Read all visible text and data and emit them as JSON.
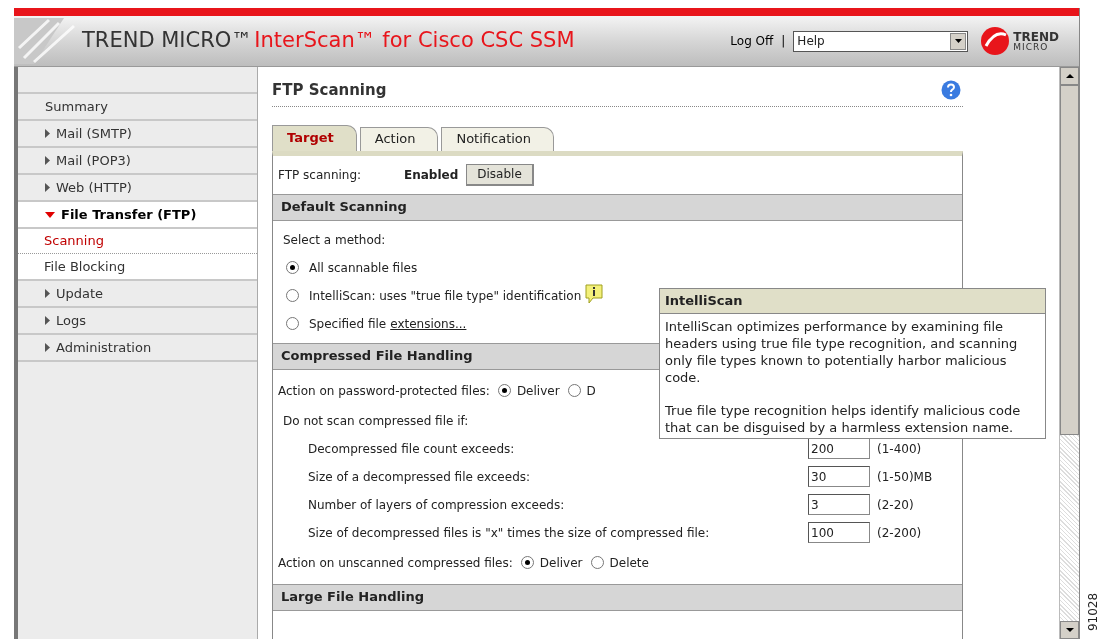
{
  "header": {
    "brand": "TREND MICRO™",
    "product": "InterScan™ for Cisco CSC SSM",
    "logoff": "Log Off",
    "separator": "|",
    "help_select": {
      "value": "Help"
    },
    "logo_text": [
      "TREND",
      "MICRO"
    ]
  },
  "sidebar": {
    "items": [
      {
        "label": "Summary",
        "kind": "link",
        "selected": false
      },
      {
        "label": "Mail (SMTP)",
        "kind": "group",
        "expanded": false,
        "selected": false
      },
      {
        "label": "Mail (POP3)",
        "kind": "group",
        "expanded": false,
        "selected": false
      },
      {
        "label": "Web (HTTP)",
        "kind": "group",
        "expanded": false,
        "selected": false
      },
      {
        "label": "File Transfer (FTP)",
        "kind": "group",
        "expanded": true,
        "selected": true,
        "children": [
          {
            "label": "Scanning",
            "selected": true
          },
          {
            "label": "File Blocking",
            "selected": false
          }
        ]
      },
      {
        "label": "Update",
        "kind": "group",
        "expanded": false,
        "selected": false
      },
      {
        "label": "Logs",
        "kind": "group",
        "expanded": false,
        "selected": false
      },
      {
        "label": "Administration",
        "kind": "group",
        "expanded": false,
        "selected": false
      }
    ]
  },
  "page": {
    "title": "FTP Scanning",
    "tabs": [
      {
        "label": "Target",
        "selected": true
      },
      {
        "label": "Action",
        "selected": false
      },
      {
        "label": "Notification",
        "selected": false
      }
    ],
    "status_row": {
      "label": "FTP scanning:",
      "value": "Enabled",
      "button": "Disable"
    },
    "sections": [
      {
        "title": "Default Scanning",
        "rows": [
          {
            "kind": "text",
            "label": "Select a method:"
          },
          {
            "kind": "option",
            "label": "All scannable files",
            "selected": true
          },
          {
            "kind": "option",
            "label": "IntelliScan: uses \"true file type\" identification",
            "selected": false,
            "info": true
          },
          {
            "kind": "option",
            "label": "Specified file",
            "link": "extensions...",
            "selected": false
          }
        ]
      },
      {
        "title": "Compressed File Handling",
        "rows": [
          {
            "kind": "radio",
            "label": "Action on password-protected files:",
            "options": [
              {
                "label": "Deliver",
                "selected": true
              },
              {
                "label": "D",
                "selected": false
              }
            ]
          },
          {
            "kind": "text",
            "label": "Do not scan compressed file if:"
          },
          {
            "kind": "number",
            "label": "Decompressed file count exceeds:",
            "value": "200",
            "range": "(1-400)"
          },
          {
            "kind": "number",
            "label": "Size of a decompressed file exceeds:",
            "value": "30",
            "range": "(1-50)MB"
          },
          {
            "kind": "number",
            "label": "Number of layers of compression exceeds:",
            "value": "3",
            "range": "(2-20)"
          },
          {
            "kind": "number",
            "label": "Size of decompressed files is \"x\" times the size of compressed file:",
            "value": "100",
            "range": "(2-200)"
          },
          {
            "kind": "radio",
            "label": "Action on unscanned compressed files:",
            "options": [
              {
                "label": "Deliver",
                "selected": true
              },
              {
                "label": "Delete",
                "selected": false
              }
            ]
          }
        ]
      },
      {
        "title": "Large File Handling"
      }
    ]
  },
  "tooltip": {
    "title": "IntelliScan",
    "paragraphs": [
      "IntelliScan optimizes performance by examining file headers using true file type recognition, and scanning only file types known to potentially harbor malicious code.",
      "True file type recognition helps identify malicious code that can be disguised by a harmless extension name."
    ]
  },
  "figure_id": "91028"
}
